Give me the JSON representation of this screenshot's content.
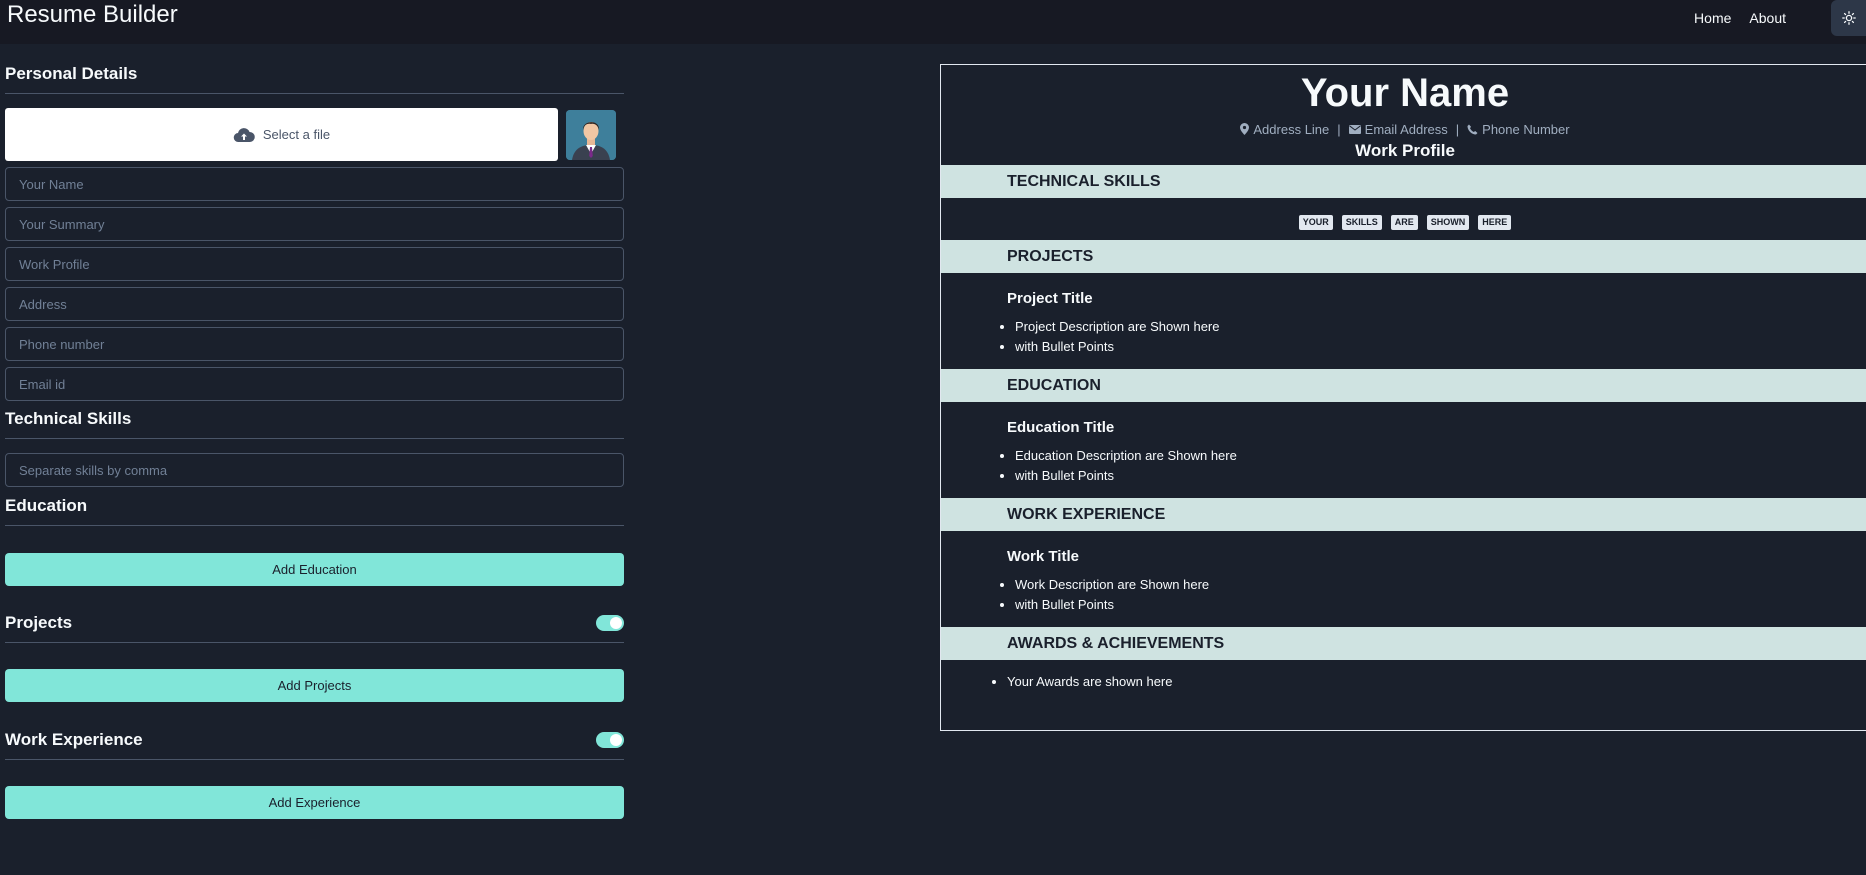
{
  "navbar": {
    "brand": "Resume Builder",
    "links": [
      "Home",
      "About"
    ],
    "theme_icon": "sun-icon"
  },
  "form": {
    "personal_details": {
      "title": "Personal Details",
      "upload_label": "Select a file",
      "fields": {
        "name": "Your Name",
        "summary": "Your Summary",
        "work_profile": "Work Profile",
        "address": "Address",
        "phone": "Phone number",
        "email": "Email id"
      }
    },
    "technical_skills": {
      "title": "Technical Skills",
      "placeholder": "Separate skills by comma"
    },
    "education": {
      "title": "Education",
      "button": "Add Education"
    },
    "projects": {
      "title": "Projects",
      "button": "Add Projects",
      "toggle_on": true
    },
    "work_experience": {
      "title": "Work Experience",
      "button": "Add Experience",
      "toggle_on": true
    }
  },
  "preview": {
    "name": "Your Name",
    "contact": {
      "address": "Address Line",
      "email": "Email Address",
      "phone": "Phone Number",
      "separator": "|"
    },
    "work_profile": "Work Profile",
    "sections": {
      "skills": {
        "heading": "TECHNICAL SKILLS",
        "tags": [
          "YOUR",
          "SKILLS",
          "ARE",
          "SHOWN",
          "HERE"
        ]
      },
      "projects": {
        "heading": "PROJECTS",
        "item_title": "Project Title",
        "bullets": [
          "Project Description are Shown here",
          "with Bullet Points"
        ]
      },
      "education": {
        "heading": "EDUCATION",
        "item_title": "Education Title",
        "bullets": [
          "Education Description are Shown here",
          "with Bullet Points"
        ]
      },
      "work": {
        "heading": "WORK EXPERIENCE",
        "item_title": "Work Title",
        "bullets": [
          "Work Description are Shown here",
          "with Bullet Points"
        ]
      },
      "awards": {
        "heading": "AWARDS & ACHIEVEMENTS",
        "bullets": [
          "Your Awards are shown here"
        ]
      }
    }
  },
  "colors": {
    "background": "#1a202c",
    "navbar": "#171923",
    "accent": "#81e6d9",
    "section_band": "#cfe3e1"
  }
}
